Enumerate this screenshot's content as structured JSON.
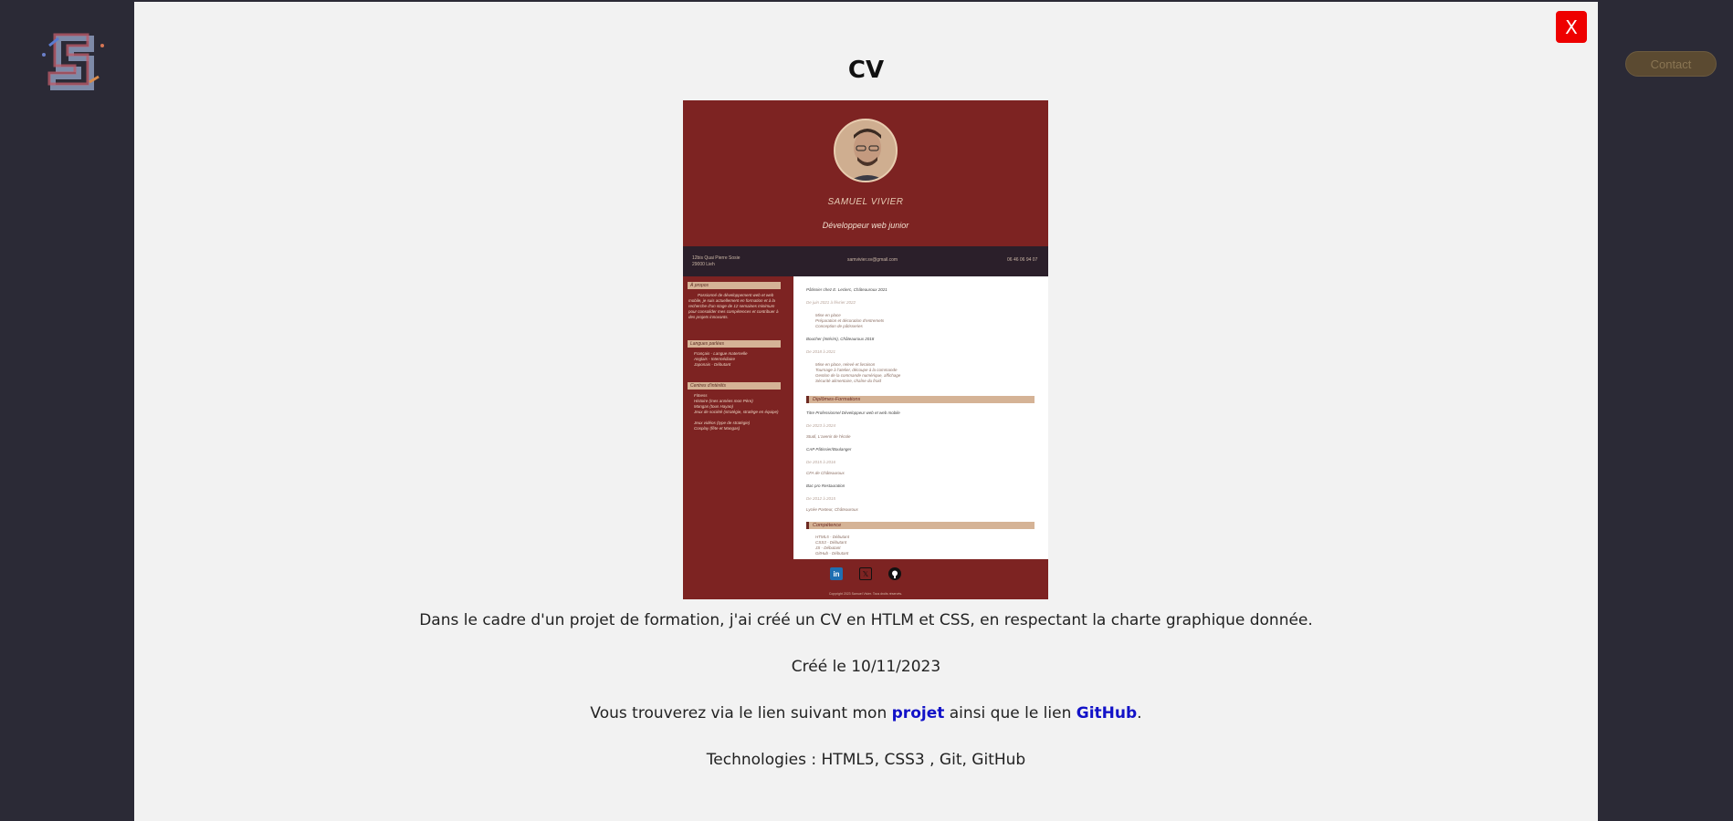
{
  "header": {
    "logo_icon": "s-brand-logo-icon",
    "contact_label": "Contact"
  },
  "modal": {
    "close_label": "X",
    "title": "CV",
    "description": "Dans le cadre d'un projet de formation, j'ai créé un CV en HTLM et CSS, en respectant la charte graphique donnée.",
    "created": "Créé le 10/11/2023",
    "links": {
      "prefix": "Vous trouverez via le lien suivant mon ",
      "project_label": "projet",
      "middle": " ainsi que le lien ",
      "github_label": "GitHub",
      "suffix": "."
    },
    "technologies": "Technologies : HTML5, CSS3 , Git, GitHub"
  },
  "cv_preview": {
    "name": "SAMUEL VIVIER",
    "job": "Développeur web junior",
    "contact": {
      "address": "12bis Quai Pierre Sosie\n29000 Lieh",
      "email": "samvivier.sv@gmail.com",
      "phone": "06 46 06 94 07"
    },
    "left": {
      "about_title": "À propos",
      "about_text": "Passionné de développement web et web mobile, je suis actuellement en formation et à la recherche d'un stage de 12 semaines minimum pour consolider mes compétences et contribuer à des projets innovants.",
      "languages_title": "Langues parlées",
      "languages": [
        "Français - Langue maternelle",
        "Anglais - Intermédiaire",
        "Japonais - Débutant"
      ],
      "interests_title": "Centres d'intérêts",
      "interests": [
        "Fitness",
        "Histoire (mes années mon Père)",
        "Mangas (tous Hayao)",
        "Jeux de société (stratégie, stratège en équipe)",
        "Jeux vidéos (type de stratégie)",
        "Cosplay (fête et Mangas)"
      ]
    },
    "right": {
      "exp1_title": "Pâtissier chez E. Leclerc, Châteauroux 2021",
      "exp1_sub": "De juin 2021 à février 2022",
      "exp1_items": [
        "Mise en place",
        "Préparation et décoration d'entremets",
        "Conception de pâtisseries"
      ],
      "exp2_title": "Boucher (Intérim), Châteauroux 2018",
      "exp2_sub": "De 2018 à 2021",
      "exp2_items": [
        "Mise en place, relevé et livraison",
        "Tournage à l'atelier, découpe à la commande",
        "Gestion de la commande numérique, affichage",
        "Sécurité alimentaire, chaîne du froid"
      ],
      "formations_title": "Diplômes-Formations",
      "f1_title": "Titre Professionnel Développeur web et web mobile",
      "f1_sub": "De 2023 à 2024",
      "f1_place": "Studi, L'avenir de l'école",
      "f2_title": "CAP Pâtissier/Boulanger",
      "f2_sub": "De 2015 à 2016",
      "f2_place": "CFA de Châteauroux",
      "f3_title": "Bac pro Restauration",
      "f3_sub": "De 2012 à 2015",
      "f3_place": "Lycée Pasteur, Châteauroux",
      "skills_title": "Compétence",
      "skills": [
        "HTML5 - Débutant",
        "CSS3 - Débutant",
        "JS - Débutant",
        "GitHub - Débutant"
      ]
    },
    "footer": {
      "icons": [
        "linkedin-icon",
        "x-icon",
        "github-icon"
      ],
      "copyright": "Copyright 2023 Samuel Vivier. Tous droits réservés."
    }
  }
}
